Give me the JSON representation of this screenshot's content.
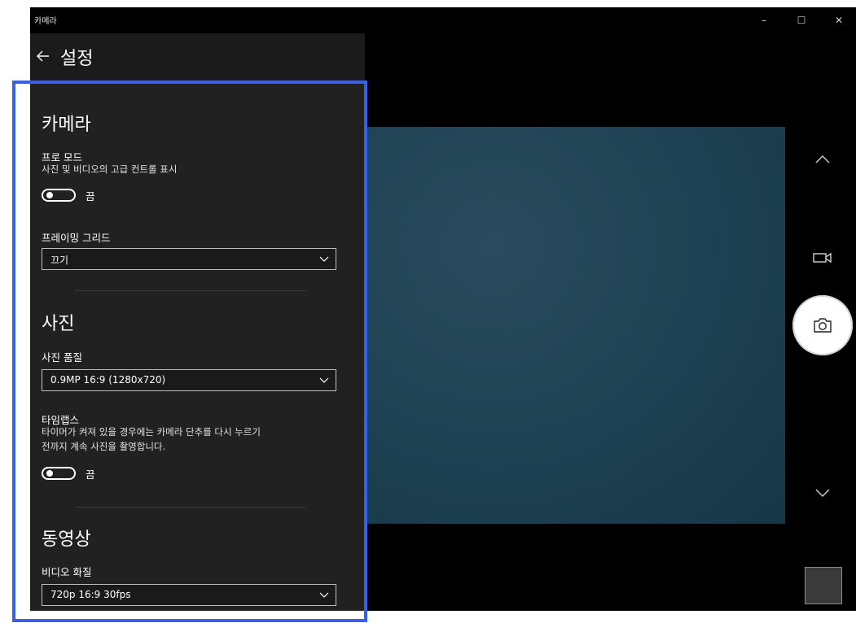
{
  "window": {
    "app_title": "카메라",
    "controls": {
      "minimize": "–",
      "maximize": "☐",
      "close": "✕"
    }
  },
  "settings": {
    "header_title": "설정",
    "camera_section": {
      "title": "카메라",
      "pro_mode_label": "프로 모드",
      "pro_mode_desc": "사진 및 비디오의 고급 컨트롤 표시",
      "pro_mode_state": "끔",
      "framing_grid_label": "프레이밍 그리드",
      "framing_grid_value": "끄기"
    },
    "photo_section": {
      "title": "사진",
      "photo_quality_label": "사진 품질",
      "photo_quality_value": "0.9MP 16:9 (1280x720)",
      "timelapse_label": "타임랩스",
      "timelapse_desc_line1": "타이머가 켜져 있을 경우에는 카메라 단추를 다시 누르기",
      "timelapse_desc_line2": "전까지 계속 사진을 촬영합니다.",
      "timelapse_state": "끔"
    },
    "video_section": {
      "title": "동영상",
      "video_quality_label": "비디오 화질",
      "video_quality_value": "720p 16:9 30fps"
    }
  },
  "camera_controls": {
    "icons": [
      "chevron-up-icon",
      "video-camera-icon",
      "camera-icon",
      "chevron-down-icon"
    ]
  },
  "colors": {
    "highlight_border": "#3461f2",
    "panel_background": "#212121",
    "preview": "#1d4152"
  }
}
